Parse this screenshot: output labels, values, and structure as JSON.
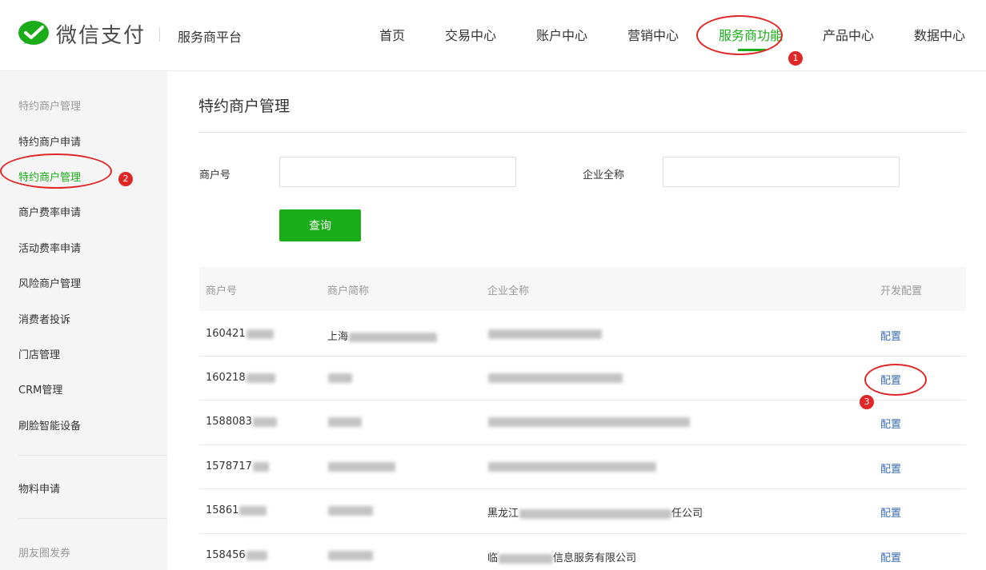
{
  "header": {
    "brand": "微信支付",
    "platform": "服务商平台",
    "nav": [
      {
        "label": "首页"
      },
      {
        "label": "交易中心"
      },
      {
        "label": "账户中心"
      },
      {
        "label": "营销中心"
      },
      {
        "label": "服务商功能",
        "active": true
      },
      {
        "label": "产品中心"
      },
      {
        "label": "数据中心"
      }
    ]
  },
  "annotations": [
    "1",
    "2",
    "3"
  ],
  "sidebar": {
    "group1": "特约商户管理",
    "items": [
      {
        "label": "特约商户申请"
      },
      {
        "label": "特约商户管理",
        "active": true
      },
      {
        "label": "商户费率申请"
      },
      {
        "label": "活动费率申请"
      },
      {
        "label": "风险商户管理"
      },
      {
        "label": "消费者投诉"
      },
      {
        "label": "门店管理"
      },
      {
        "label": "CRM管理"
      },
      {
        "label": "刷脸智能设备"
      }
    ],
    "item_material": "物料申请",
    "group2": "朋友圈发券"
  },
  "main": {
    "title": "特约商户管理",
    "merchant_no_label": "商户号",
    "company_label": "企业全称",
    "merchant_no_value": "",
    "company_value": "",
    "query_label": "查询"
  },
  "table": {
    "headers": [
      "商户号",
      "商户简称",
      "企业全称",
      "开发配置"
    ],
    "rows": [
      {
        "id": "160421",
        "short": "上海",
        "full": "",
        "action": "配置"
      },
      {
        "id": "160218",
        "short": "",
        "full": "",
        "action": "配置"
      },
      {
        "id": "1588083",
        "short": "",
        "full": "",
        "action": "配置"
      },
      {
        "id": "1578717",
        "short": "",
        "full": "",
        "action": "配置"
      },
      {
        "id": "15861",
        "short": "",
        "full_prefix": "黑龙江",
        "full_suffix": "任公司",
        "action": "配置"
      },
      {
        "id": "158456",
        "short": "",
        "full_prefix": "临",
        "full_suffix": "信息服务有限公司",
        "action": "配置"
      }
    ]
  },
  "colors": {
    "brand_green": "#1aad19",
    "link_blue": "#3a6db5",
    "annotation_red": "#e02727"
  }
}
